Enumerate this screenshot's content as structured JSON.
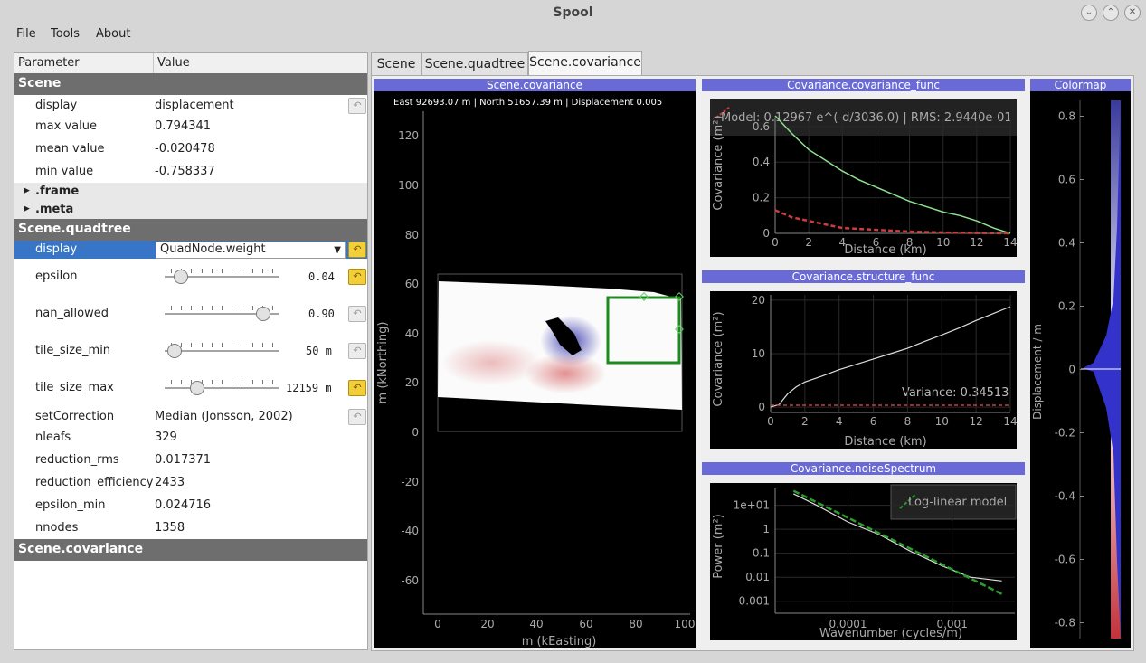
{
  "window": {
    "title": "Spool"
  },
  "menu": {
    "file": "File",
    "tools": "Tools",
    "about": "About"
  },
  "params": {
    "header_param": "Parameter",
    "header_value": "Value",
    "scene": {
      "title": "Scene",
      "display_label": "display",
      "display_value": "displacement",
      "max_label": "max value",
      "max_value": "0.794341",
      "mean_label": "mean value",
      "mean_value": "-0.020478",
      "min_label": "min value",
      "min_value": "-0.758337",
      "frame": ".frame",
      "meta": ".meta"
    },
    "quadtree": {
      "title": "Scene.quadtree",
      "display_label": "display",
      "display_value": "QuadNode.weight",
      "epsilon_label": "epsilon",
      "epsilon_value": "0.04",
      "epsilon_pos": 0.09,
      "nan_label": "nan_allowed",
      "nan_value": "0.90",
      "nan_pos": 0.9,
      "tmin_label": "tile_size_min",
      "tmin_value": "50 m",
      "tmin_pos": 0.03,
      "tmax_label": "tile_size_max",
      "tmax_value": "12159 m",
      "tmax_pos": 0.25,
      "setcorr_label": "setCorrection",
      "setcorr_value": "Median (Jonsson, 2002)",
      "nleafs_label": "nleafs",
      "nleafs_value": "329",
      "rrms_label": "reduction_rms",
      "rrms_value": "0.017371",
      "reff_label": "reduction_efficiency",
      "reff_value": "2433",
      "emin_label": "epsilon_min",
      "emin_value": "0.024716",
      "nnodes_label": "nnodes",
      "nnodes_value": "1358"
    },
    "covariance": {
      "title": "Scene.covariance"
    }
  },
  "tabs": {
    "scene": "Scene",
    "quadtree": "Scene.quadtree",
    "covariance": "Scene.covariance"
  },
  "scene_plot": {
    "title": "Scene.covariance",
    "readout": "East 92693.07 m | North 51657.39 m | Displacement 0.005",
    "xlabel": "m (kEasting)",
    "ylabel": "m (kNorthing)",
    "xticks": [
      "0",
      "20",
      "40",
      "60",
      "80",
      "100"
    ],
    "yticks": [
      "120",
      "100",
      "80",
      "60",
      "40",
      "20",
      "0",
      "-20",
      "-40",
      "-60"
    ]
  },
  "chart_data": [
    {
      "type": "line",
      "title": "Covariance.covariance_func",
      "xlabel": "Distance (km)",
      "ylabel": "Covariance (m²)",
      "xlim": [
        0,
        14
      ],
      "ylim": [
        0,
        0.65
      ],
      "xticks": [
        "0",
        "2",
        "4",
        "6",
        "8",
        "10",
        "12",
        "14"
      ],
      "yticks": [
        "0",
        "0.2",
        "0.4",
        "0.6"
      ],
      "legend": "Model: 0.12967 e^(-d/3036.0) | RMS: 2.9440e-01",
      "series": [
        {
          "x": [
            0,
            1,
            2,
            3,
            4,
            5,
            6,
            7,
            8,
            9,
            10,
            11,
            12,
            13,
            14
          ],
          "y": [
            0.66,
            0.56,
            0.47,
            0.41,
            0.35,
            0.3,
            0.26,
            0.22,
            0.18,
            0.15,
            0.12,
            0.1,
            0.07,
            0.03,
            0.0
          ]
        },
        {
          "x": [
            0,
            1,
            2,
            3,
            4,
            6,
            8,
            10,
            12,
            14
          ],
          "y": [
            0.13,
            0.09,
            0.07,
            0.05,
            0.03,
            0.02,
            0.01,
            0.005,
            0.002,
            0.0
          ]
        }
      ]
    },
    {
      "type": "line",
      "title": "Covariance.structure_func",
      "xlabel": "Distance (km)",
      "ylabel": "Covariance (m²)",
      "xlim": [
        0,
        14
      ],
      "ylim": [
        -1,
        21
      ],
      "xticks": [
        "0",
        "2",
        "4",
        "6",
        "8",
        "10",
        "12",
        "14"
      ],
      "yticks": [
        "0",
        "10",
        "20"
      ],
      "annotation": "Variance: 0.34513",
      "series": [
        {
          "x": [
            0,
            0.5,
            1,
            1.5,
            2,
            3,
            4,
            5,
            6,
            7,
            8,
            9,
            10,
            11,
            12,
            13,
            14
          ],
          "y": [
            0,
            0.5,
            2.5,
            3.8,
            4.7,
            5.8,
            7,
            8,
            9,
            10,
            11,
            12.3,
            13.5,
            14.8,
            16.2,
            17.5,
            18.8
          ]
        },
        {
          "x": [
            0,
            14
          ],
          "y": [
            0.35,
            0.35
          ]
        }
      ]
    },
    {
      "type": "line",
      "title": "Covariance.noiseSpectrum",
      "xlabel": "Wavenumber (cycles/m)",
      "ylabel": "Power (m²)",
      "legend": "Log-linear model",
      "xticks": [
        "0.0001",
        "0.001"
      ],
      "yticks": [
        "1e+01",
        "1",
        "0.1",
        "0.01",
        "0.001"
      ],
      "series": [
        {
          "x": [
            3e-05,
            5e-05,
            0.0001,
            0.0002,
            0.0004,
            0.0008,
            0.0015,
            0.003
          ],
          "y": [
            30,
            10,
            2,
            0.6,
            0.12,
            0.03,
            0.01,
            0.007
          ]
        },
        {
          "x": [
            3e-05,
            0.003
          ],
          "y": [
            40,
            0.002
          ]
        }
      ]
    },
    {
      "type": "area",
      "title": "Colormap",
      "ylabel": "Displacement / m",
      "yticks": [
        "0.8",
        "0.6",
        "0.4",
        "0.2",
        "0",
        "-0.2",
        "-0.4",
        "-0.6",
        "-0.8"
      ],
      "ylim": [
        -0.85,
        0.85
      ]
    }
  ]
}
